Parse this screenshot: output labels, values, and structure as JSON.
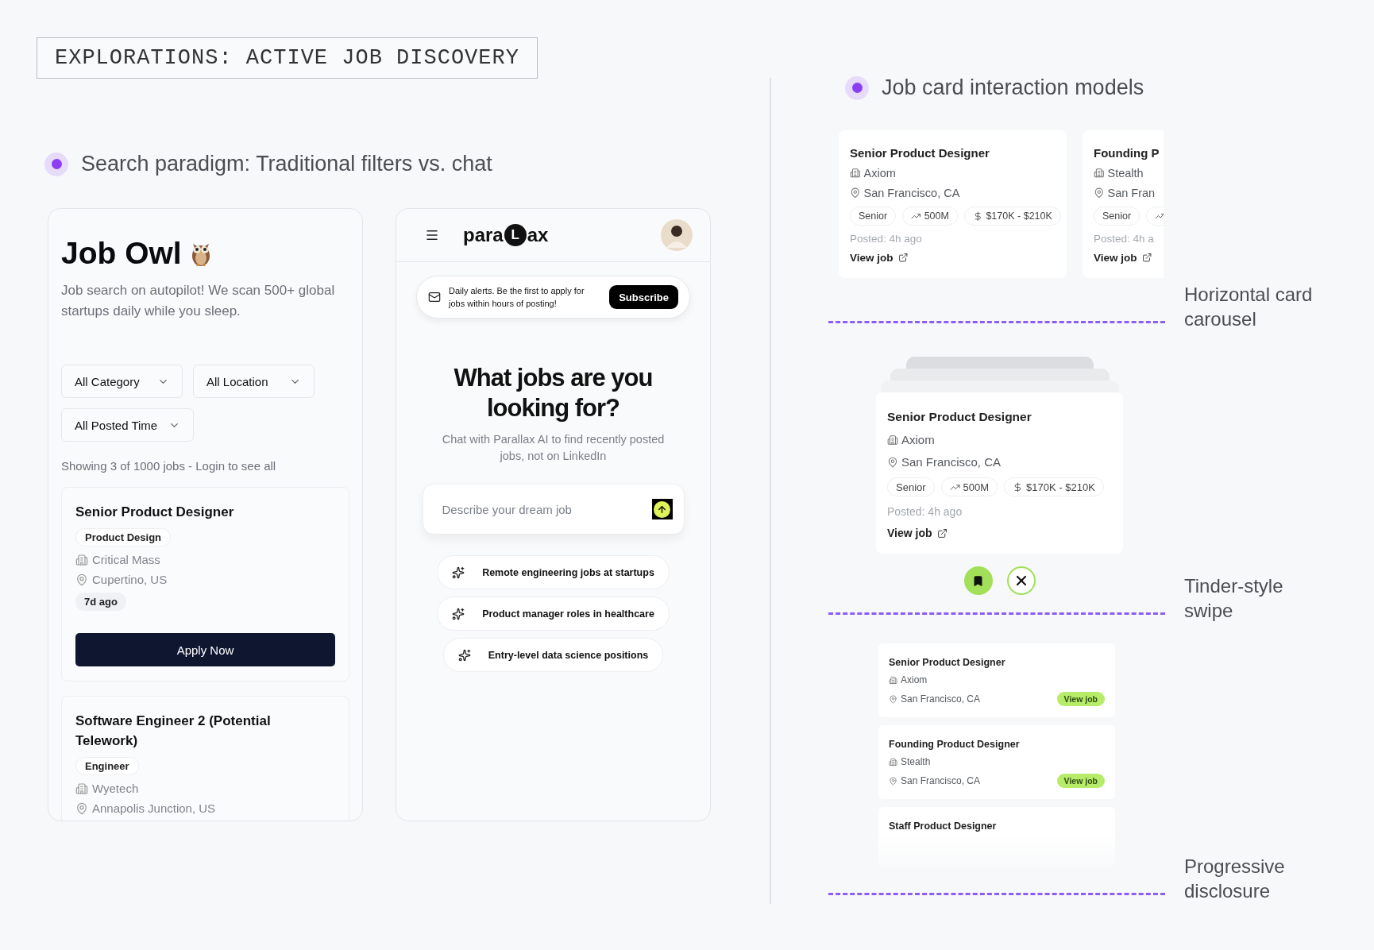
{
  "title": "EXPLORATIONS: ACTIVE JOB DISCOVERY",
  "search_section": {
    "heading": "Search paradigm: Traditional filters vs. chat",
    "job_owl": {
      "title": "Job Owl",
      "description": "Job search on autopilot! We scan 500+ global startups daily while you sleep.",
      "filters": [
        "All Category",
        "All Location",
        "All Posted Time"
      ],
      "count": "Showing 3 of 1000 jobs - Login to see all",
      "jobs": [
        {
          "title": "Senior Product Designer",
          "tag": "Product Design",
          "company": "Critical Mass",
          "location": "Cupertino, US",
          "age": "7d ago",
          "button": "Apply Now"
        },
        {
          "title": "Software Engineer 2 (Potential Telework)",
          "tag": "Engineer",
          "company": "Wyetech",
          "location": "Annapolis Junction, US"
        }
      ]
    },
    "parallax": {
      "logo": [
        "para",
        "L",
        "ax"
      ],
      "alert": "Daily alerts. Be the first to apply for jobs within hours of posting!",
      "subscribe": "Subscribe",
      "heading": "What jobs are you looking for?",
      "subheading": "Chat with Parallax AI to find recently posted jobs, not on LinkedIn",
      "input": {
        "placeholder": "Describe your dream job"
      },
      "suggestions": [
        "Remote engineering jobs at startups",
        "Product manager roles in healthcare",
        "Entry-level data science positions"
      ]
    }
  },
  "interaction_section": {
    "heading": "Job card interaction models",
    "models": [
      {
        "kind": "carousel",
        "label": "Horizontal card carousel",
        "cards": [
          {
            "title": "Senior Product Designer",
            "company": "Axiom",
            "location": "San Francisco, CA",
            "chips": [
              {
                "kind": "level",
                "text": "Senior"
              },
              {
                "kind": "funding",
                "text": "500M"
              },
              {
                "kind": "salary",
                "text": "$170K - $210K"
              }
            ],
            "posted": "Posted: 4h ago",
            "link": "View job"
          },
          {
            "title": "Founding P",
            "company": "Stealth",
            "location": "San Fran",
            "chips": [
              {
                "kind": "level",
                "text": "Senior"
              },
              {
                "kind": "funding"
              }
            ],
            "posted": "Posted: 4h a",
            "link": "View job"
          }
        ]
      },
      {
        "kind": "swipe",
        "label": "Tinder-style swipe",
        "cards": [
          {
            "title": "Senior Product Designer",
            "company": "Axiom",
            "location": "San Francisco, CA",
            "chips": [
              {
                "kind": "level",
                "text": "Senior"
              },
              {
                "kind": "funding",
                "text": "500M"
              },
              {
                "kind": "salary",
                "text": "$170K - $210K"
              }
            ],
            "posted": "Posted: 4h ago",
            "link": "View job"
          }
        ]
      },
      {
        "kind": "list",
        "label": "Progressive disclosure",
        "cards": [
          {
            "title": "Senior Product Designer",
            "company": "Axiom",
            "location": "San Francisco, CA",
            "link": "View job"
          },
          {
            "title": "Founding Product Designer",
            "company": "Stealth",
            "location": "San Francisco, CA",
            "link": "View job"
          },
          {
            "title": "Staff Product Designer"
          }
        ]
      }
    ]
  }
}
